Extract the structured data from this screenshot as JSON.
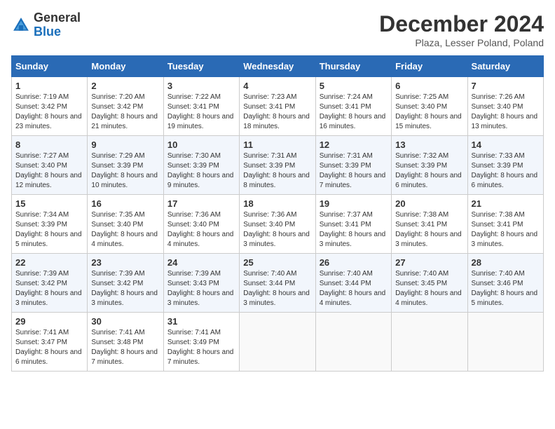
{
  "header": {
    "logo_general": "General",
    "logo_blue": "Blue",
    "title": "December 2024",
    "location": "Plaza, Lesser Poland, Poland"
  },
  "days_of_week": [
    "Sunday",
    "Monday",
    "Tuesday",
    "Wednesday",
    "Thursday",
    "Friday",
    "Saturday"
  ],
  "weeks": [
    [
      {
        "day": "1",
        "sunrise": "7:19 AM",
        "sunset": "3:42 PM",
        "daylight": "8 hours and 23 minutes."
      },
      {
        "day": "2",
        "sunrise": "7:20 AM",
        "sunset": "3:42 PM",
        "daylight": "8 hours and 21 minutes."
      },
      {
        "day": "3",
        "sunrise": "7:22 AM",
        "sunset": "3:41 PM",
        "daylight": "8 hours and 19 minutes."
      },
      {
        "day": "4",
        "sunrise": "7:23 AM",
        "sunset": "3:41 PM",
        "daylight": "8 hours and 18 minutes."
      },
      {
        "day": "5",
        "sunrise": "7:24 AM",
        "sunset": "3:41 PM",
        "daylight": "8 hours and 16 minutes."
      },
      {
        "day": "6",
        "sunrise": "7:25 AM",
        "sunset": "3:40 PM",
        "daylight": "8 hours and 15 minutes."
      },
      {
        "day": "7",
        "sunrise": "7:26 AM",
        "sunset": "3:40 PM",
        "daylight": "8 hours and 13 minutes."
      }
    ],
    [
      {
        "day": "8",
        "sunrise": "7:27 AM",
        "sunset": "3:40 PM",
        "daylight": "8 hours and 12 minutes."
      },
      {
        "day": "9",
        "sunrise": "7:29 AM",
        "sunset": "3:39 PM",
        "daylight": "8 hours and 10 minutes."
      },
      {
        "day": "10",
        "sunrise": "7:30 AM",
        "sunset": "3:39 PM",
        "daylight": "8 hours and 9 minutes."
      },
      {
        "day": "11",
        "sunrise": "7:31 AM",
        "sunset": "3:39 PM",
        "daylight": "8 hours and 8 minutes."
      },
      {
        "day": "12",
        "sunrise": "7:31 AM",
        "sunset": "3:39 PM",
        "daylight": "8 hours and 7 minutes."
      },
      {
        "day": "13",
        "sunrise": "7:32 AM",
        "sunset": "3:39 PM",
        "daylight": "8 hours and 6 minutes."
      },
      {
        "day": "14",
        "sunrise": "7:33 AM",
        "sunset": "3:39 PM",
        "daylight": "8 hours and 6 minutes."
      }
    ],
    [
      {
        "day": "15",
        "sunrise": "7:34 AM",
        "sunset": "3:39 PM",
        "daylight": "8 hours and 5 minutes."
      },
      {
        "day": "16",
        "sunrise": "7:35 AM",
        "sunset": "3:40 PM",
        "daylight": "8 hours and 4 minutes."
      },
      {
        "day": "17",
        "sunrise": "7:36 AM",
        "sunset": "3:40 PM",
        "daylight": "8 hours and 4 minutes."
      },
      {
        "day": "18",
        "sunrise": "7:36 AM",
        "sunset": "3:40 PM",
        "daylight": "8 hours and 3 minutes."
      },
      {
        "day": "19",
        "sunrise": "7:37 AM",
        "sunset": "3:41 PM",
        "daylight": "8 hours and 3 minutes."
      },
      {
        "day": "20",
        "sunrise": "7:38 AM",
        "sunset": "3:41 PM",
        "daylight": "8 hours and 3 minutes."
      },
      {
        "day": "21",
        "sunrise": "7:38 AM",
        "sunset": "3:41 PM",
        "daylight": "8 hours and 3 minutes."
      }
    ],
    [
      {
        "day": "22",
        "sunrise": "7:39 AM",
        "sunset": "3:42 PM",
        "daylight": "8 hours and 3 minutes."
      },
      {
        "day": "23",
        "sunrise": "7:39 AM",
        "sunset": "3:42 PM",
        "daylight": "8 hours and 3 minutes."
      },
      {
        "day": "24",
        "sunrise": "7:39 AM",
        "sunset": "3:43 PM",
        "daylight": "8 hours and 3 minutes."
      },
      {
        "day": "25",
        "sunrise": "7:40 AM",
        "sunset": "3:44 PM",
        "daylight": "8 hours and 3 minutes."
      },
      {
        "day": "26",
        "sunrise": "7:40 AM",
        "sunset": "3:44 PM",
        "daylight": "8 hours and 4 minutes."
      },
      {
        "day": "27",
        "sunrise": "7:40 AM",
        "sunset": "3:45 PM",
        "daylight": "8 hours and 4 minutes."
      },
      {
        "day": "28",
        "sunrise": "7:40 AM",
        "sunset": "3:46 PM",
        "daylight": "8 hours and 5 minutes."
      }
    ],
    [
      {
        "day": "29",
        "sunrise": "7:41 AM",
        "sunset": "3:47 PM",
        "daylight": "8 hours and 6 minutes."
      },
      {
        "day": "30",
        "sunrise": "7:41 AM",
        "sunset": "3:48 PM",
        "daylight": "8 hours and 7 minutes."
      },
      {
        "day": "31",
        "sunrise": "7:41 AM",
        "sunset": "3:49 PM",
        "daylight": "8 hours and 7 minutes."
      },
      null,
      null,
      null,
      null
    ]
  ]
}
